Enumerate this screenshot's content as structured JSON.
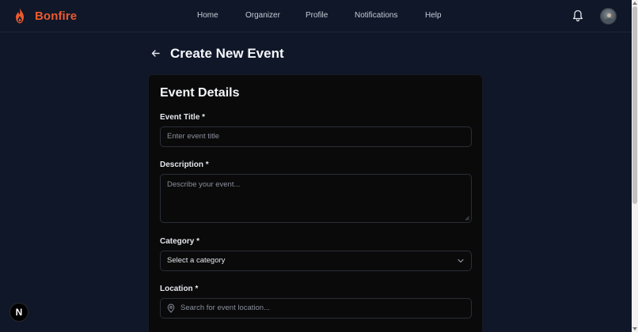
{
  "nav": {
    "brand": "Bonfire",
    "links": [
      "Home",
      "Organizer",
      "Profile",
      "Notifications",
      "Help"
    ],
    "icons": [
      "flame-logo-icon",
      "bell-icon",
      "avatar"
    ],
    "brand_color": "#ea5a2f"
  },
  "header": {
    "title": "Create New Event"
  },
  "form": {
    "section_title": "Event Details",
    "title_label": "Event Title *",
    "title_placeholder": "Enter event title",
    "description_label": "Description *",
    "description_placeholder": "Describe your event...",
    "category_label": "Category *",
    "category_value": "Select a category",
    "location_label": "Location *",
    "location_placeholder": "Search for event location..."
  },
  "badge": {
    "letter": "N"
  },
  "colors": {
    "background": "#0f1729",
    "card": "#0a0a0b",
    "accent": "#ea5a2f"
  }
}
